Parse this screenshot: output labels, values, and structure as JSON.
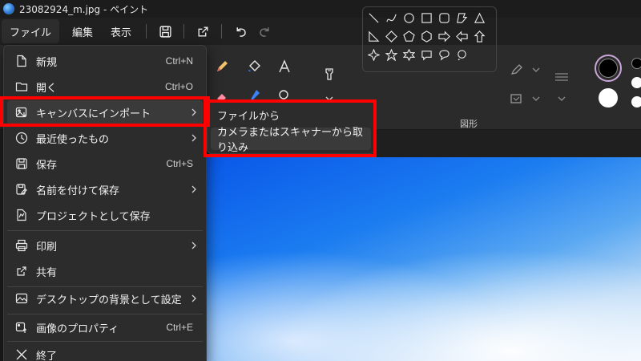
{
  "titlebar": {
    "title": "23082924_m.jpg - ペイント"
  },
  "menubar": {
    "file": "ファイル",
    "edit": "編集",
    "view": "表示"
  },
  "ribbon": {
    "shapes_label": "図形"
  },
  "file_menu": {
    "items": [
      {
        "label": "新規",
        "shortcut": "Ctrl+N"
      },
      {
        "label": "開く",
        "shortcut": "Ctrl+O"
      },
      {
        "label": "キャンバスにインポート",
        "submenu": true
      },
      {
        "label": "最近使ったもの",
        "submenu": true
      },
      {
        "label": "保存",
        "shortcut": "Ctrl+S"
      },
      {
        "label": "名前を付けて保存",
        "submenu": true
      },
      {
        "label": "プロジェクトとして保存"
      },
      {
        "label": "印刷",
        "submenu": true
      },
      {
        "label": "共有"
      },
      {
        "label": "デスクトップの背景として設定",
        "submenu": true
      },
      {
        "label": "画像のプロパティ",
        "shortcut": "Ctrl+E"
      },
      {
        "label": "終了"
      }
    ]
  },
  "submenu": {
    "items": [
      {
        "label": "ファイルから"
      },
      {
        "label": "カメラまたはスキャナーから取り込み"
      }
    ]
  },
  "colors": {
    "highlight": "#ff0000",
    "menu_bg": "#2c2c2c",
    "accent_ring": "#c9a5d8"
  }
}
